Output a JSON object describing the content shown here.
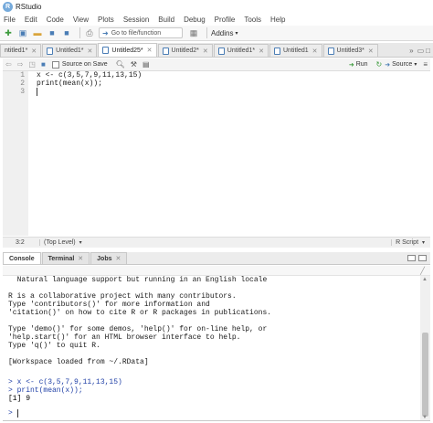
{
  "window": {
    "title": "RStudio",
    "logo_letter": "R"
  },
  "menu": [
    "File",
    "Edit",
    "Code",
    "View",
    "Plots",
    "Session",
    "Build",
    "Debug",
    "Profile",
    "Tools",
    "Help"
  ],
  "toolbar": {
    "goto_placeholder": "Go to file/function",
    "addins_label": "Addins"
  },
  "editor_tabs": [
    {
      "label": "ntitled1*",
      "active": false
    },
    {
      "label": "Untitled1*",
      "active": false
    },
    {
      "label": "Untitled25*",
      "active": true
    },
    {
      "label": "Untitled2*",
      "active": false
    },
    {
      "label": "Untitled1*",
      "active": false
    },
    {
      "label": "Untitled1",
      "active": false
    },
    {
      "label": "Untitled3*",
      "active": false
    }
  ],
  "editor_toolbar": {
    "source_on_save": "Source on Save",
    "run_label": "Run",
    "source_label": "Source"
  },
  "editor": {
    "lines": [
      {
        "num": "1",
        "text": "x <- c(3,5,7,9,11,13,15)"
      },
      {
        "num": "2",
        "text": "print(mean(x));"
      },
      {
        "num": "3",
        "text": ""
      }
    ]
  },
  "editor_status": {
    "position": "3:2",
    "scope": "(Top Level)",
    "file_type": "R Script"
  },
  "console_tabs": [
    {
      "label": "Console",
      "active": true
    },
    {
      "label": "Terminal",
      "active": false
    },
    {
      "label": "Jobs",
      "active": false
    }
  ],
  "console": {
    "lines": [
      {
        "text": "  Natural language support but running in an English locale",
        "kind": "output"
      },
      {
        "text": "",
        "kind": "output"
      },
      {
        "text": "R is a collaborative project with many contributors.",
        "kind": "output"
      },
      {
        "text": "Type 'contributors()' for more information and",
        "kind": "output"
      },
      {
        "text": "'citation()' on how to cite R or R packages in publications.",
        "kind": "output"
      },
      {
        "text": "",
        "kind": "output"
      },
      {
        "text": "Type 'demo()' for some demos, 'help()' for on-line help, or",
        "kind": "output"
      },
      {
        "text": "'help.start()' for an HTML browser interface to help.",
        "kind": "output"
      },
      {
        "text": "Type 'q()' to quit R.",
        "kind": "output"
      },
      {
        "text": "",
        "kind": "output"
      },
      {
        "text": "[Workspace loaded from ~/.RData]",
        "kind": "output"
      },
      {
        "text": "",
        "kind": "output"
      },
      {
        "text": "> x <- c(3,5,7,9,11,13,15)",
        "kind": "input"
      },
      {
        "text": "> print(mean(x));",
        "kind": "input"
      },
      {
        "text": "[1] 9",
        "kind": "result"
      },
      {
        "text": ">",
        "kind": "input"
      }
    ]
  },
  "colors": {
    "accent": "#4a7db5",
    "run_green": "#3b9a3b",
    "console_input": "#1f3fa6"
  }
}
